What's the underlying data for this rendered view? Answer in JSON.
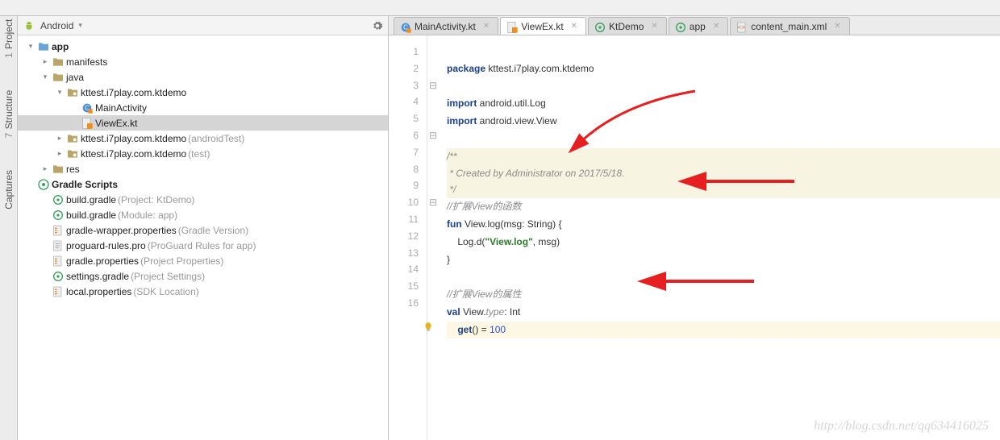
{
  "view_dropdown": "Android",
  "left_tools": [
    {
      "n": "1",
      "label": "Project"
    },
    {
      "n": "7",
      "label": "Structure"
    },
    {
      "n": "",
      "label": "Captures"
    }
  ],
  "tree": [
    {
      "depth": 0,
      "twist": "▾",
      "icon": "folder-app",
      "label": "app",
      "bold": true
    },
    {
      "depth": 1,
      "twist": "▸",
      "icon": "folder",
      "label": "manifests"
    },
    {
      "depth": 1,
      "twist": "▾",
      "icon": "folder",
      "label": "java"
    },
    {
      "depth": 2,
      "twist": "▾",
      "icon": "package",
      "label": "kttest.i7play.com.ktdemo"
    },
    {
      "depth": 3,
      "twist": "",
      "icon": "class-kt",
      "label": "MainActivity"
    },
    {
      "depth": 3,
      "twist": "",
      "icon": "file-kt",
      "label": "ViewEx.kt",
      "selected": true
    },
    {
      "depth": 2,
      "twist": "▸",
      "icon": "package",
      "label": "kttest.i7play.com.ktdemo",
      "suffix": " (androidTest)"
    },
    {
      "depth": 2,
      "twist": "▸",
      "icon": "package",
      "label": "kttest.i7play.com.ktdemo",
      "suffix": " (test)"
    },
    {
      "depth": 1,
      "twist": "▸",
      "icon": "folder",
      "label": "res"
    },
    {
      "depth": 0,
      "twist": "",
      "icon": "gradle",
      "label": "Gradle Scripts",
      "bold": true
    },
    {
      "depth": 1,
      "twist": "",
      "icon": "gradle-f",
      "label": "build.gradle",
      "suffix": " (Project: KtDemo)"
    },
    {
      "depth": 1,
      "twist": "",
      "icon": "gradle-f",
      "label": "build.gradle",
      "suffix": " (Module: app)"
    },
    {
      "depth": 1,
      "twist": "",
      "icon": "props",
      "label": "gradle-wrapper.properties",
      "suffix": " (Gradle Version)"
    },
    {
      "depth": 1,
      "twist": "",
      "icon": "txt",
      "label": "proguard-rules.pro",
      "suffix": " (ProGuard Rules for app)"
    },
    {
      "depth": 1,
      "twist": "",
      "icon": "props",
      "label": "gradle.properties",
      "suffix": " (Project Properties)"
    },
    {
      "depth": 1,
      "twist": "",
      "icon": "gradle-f",
      "label": "settings.gradle",
      "suffix": " (Project Settings)"
    },
    {
      "depth": 1,
      "twist": "",
      "icon": "props",
      "label": "local.properties",
      "suffix": " (SDK Location)"
    }
  ],
  "tabs": [
    {
      "icon": "class-kt",
      "label": "MainActivity.kt"
    },
    {
      "icon": "file-kt",
      "label": "ViewEx.kt",
      "active": true
    },
    {
      "icon": "gradle-f",
      "label": "KtDemo"
    },
    {
      "icon": "gradle-f",
      "label": "app"
    },
    {
      "icon": "xml",
      "label": "content_main.xml"
    }
  ],
  "code": {
    "lines": 16,
    "l1_kw": "package",
    "l1_rest": " kttest.i7play.com.ktdemo",
    "l3_kw": "import",
    "l3_rest": " android.util.Log",
    "l4_kw": "import",
    "l4_rest": " android.view.View",
    "l6": "/**",
    "l7": " * Created by Administrator on 2017/5/18.",
    "l8": " */",
    "l9_a": "//扩展",
    "l9_b": "View",
    "l9_c": "的函数",
    "l10_kw": "fun",
    "l10_rest": " View.log(msg: String) {",
    "l11_a": "    Log.d(",
    "l11_str": "\"View.log\"",
    "l11_b": ", msg)",
    "l12": "}",
    "l14_a": "//扩展",
    "l14_b": "View",
    "l14_c": "的属性",
    "l15_kw": "val",
    "l15_rest": " View.",
    "l15_i": "type",
    "l15_end": ": Int",
    "l16_kw": "get",
    "l16_a": "() = ",
    "l16_num": "100"
  },
  "watermark": "http://blog.csdn.net/qq634416025"
}
